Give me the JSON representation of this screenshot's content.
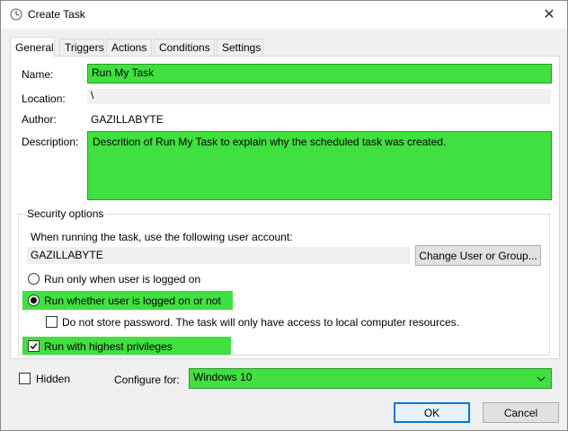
{
  "window": {
    "title": "Create Task",
    "close_glyph": "✕"
  },
  "tabs": [
    {
      "label": "General"
    },
    {
      "label": "Triggers"
    },
    {
      "label": "Actions"
    },
    {
      "label": "Conditions"
    },
    {
      "label": "Settings"
    }
  ],
  "general": {
    "name_label": "Name:",
    "name_value": "Run My Task",
    "location_label": "Location:",
    "location_value": "\\",
    "author_label": "Author:",
    "author_value": "GAZILLABYTE",
    "description_label": "Description:",
    "description_value": "Descrition of Run My Task to explain why the scheduled task was created."
  },
  "security": {
    "group_title": "Security options",
    "account_prompt": "When running the task, use the following user account:",
    "account_value": "GAZILLABYTE",
    "change_button": "Change User or Group...",
    "radio_logged_on": "Run only when user is logged on",
    "radio_whether": "Run whether user is logged on or not",
    "no_store_password": "Do not store password.  The task will only have access to local computer resources.",
    "highest_privileges": "Run with highest privileges",
    "highest_checked": true,
    "whether_selected": true
  },
  "bottom": {
    "hidden_label": "Hidden",
    "configure_label": "Configure for:",
    "configure_value": "Windows 10"
  },
  "buttons": {
    "ok": "OK",
    "cancel": "Cancel"
  },
  "colors": {
    "highlight": "#40e040",
    "accent": "#0078d7"
  },
  "icons": {
    "app": "clock-icon",
    "close": "close-icon",
    "dropdown": "chevron-down-icon",
    "check": "checkmark-icon"
  }
}
